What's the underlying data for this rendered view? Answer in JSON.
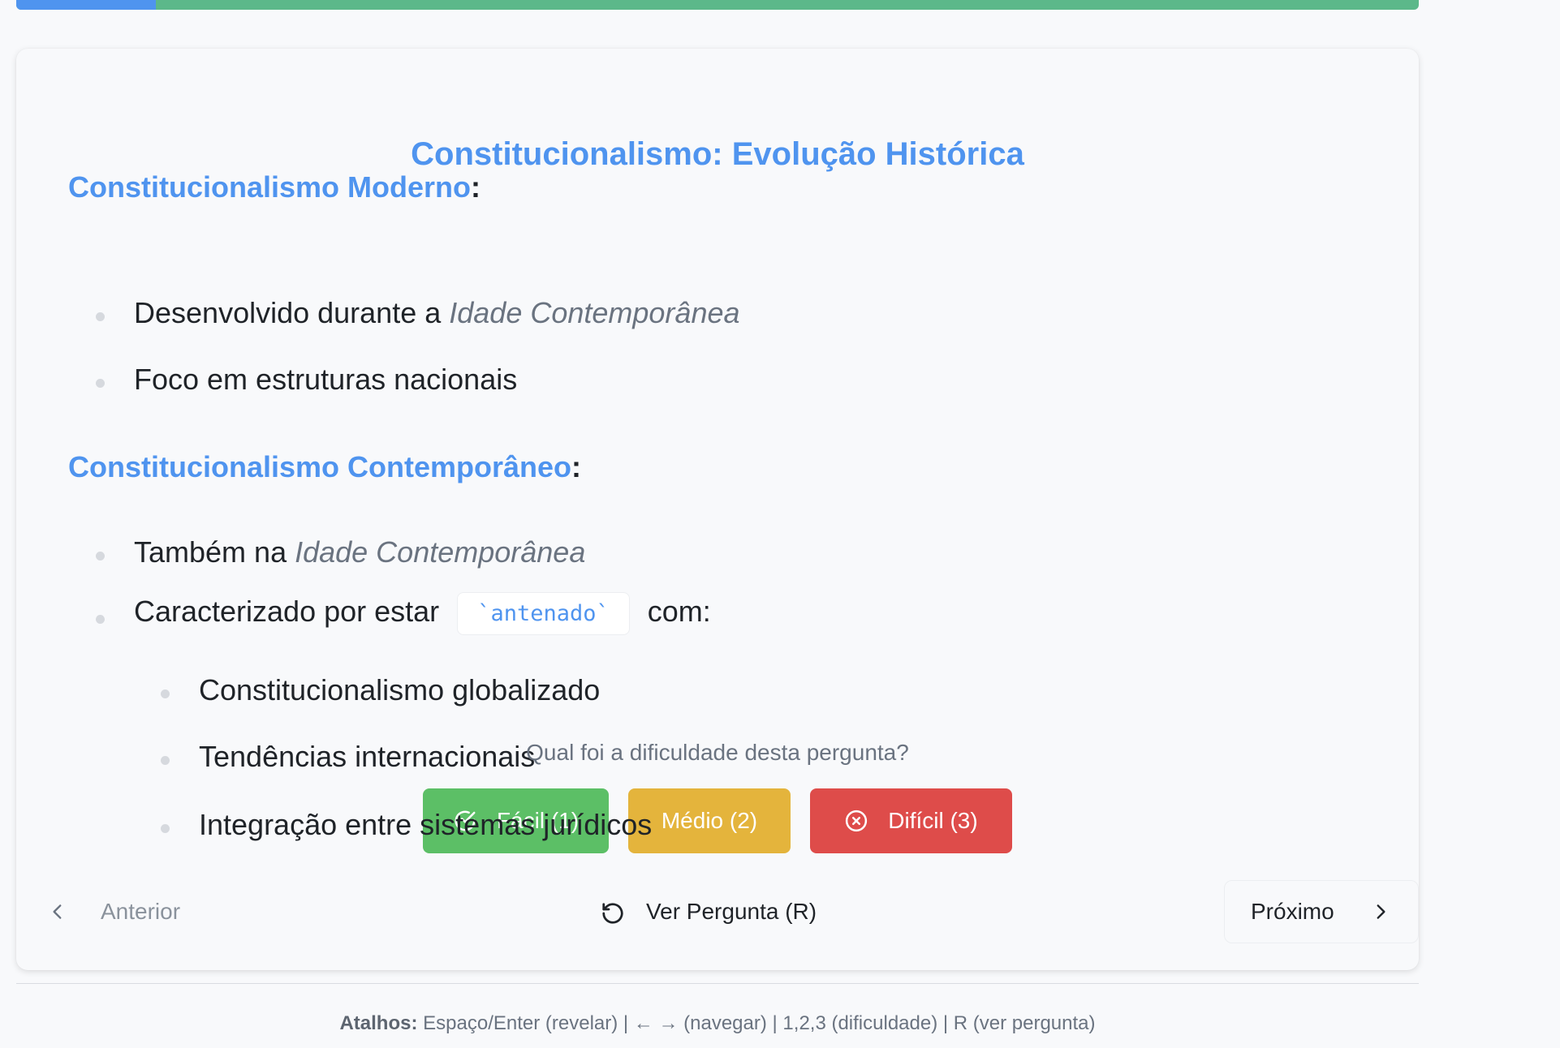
{
  "progress": {
    "fraction": 0.0995,
    "fill_color": "#4f94ef",
    "track_color": "#5cb88a"
  },
  "card": {
    "title": "Constitucionalismo: Evolução Histórica",
    "sections": [
      {
        "heading": "Constitucionalismo Moderno",
        "suffix": ":",
        "bullets": [
          {
            "text": "Desenvolvido durante a ",
            "emphasis": "Idade Contemporânea"
          },
          {
            "text": "Foco em estruturas nacionais"
          }
        ]
      },
      {
        "heading": "Constitucionalismo Contemporâneo",
        "suffix": ":",
        "bullets": [
          {
            "text": "Também na ",
            "emphasis": "Idade Contemporânea"
          },
          {
            "text": "Caracterizado por estar ",
            "code": "`antenado`",
            "after": " com:"
          }
        ],
        "sub_bullets": [
          "Constitucionalismo globalizado",
          "Tendências internacionais",
          "Integração entre sistemas jurídicos"
        ]
      }
    ]
  },
  "difficulty": {
    "question": "Qual foi a dificuldade desta pergunta?",
    "easy_label": "Fácil (1)",
    "medium_label": "Médio (2)",
    "hard_label": "Difícil (3)",
    "easy_color": "#5cbf66",
    "medium_color": "#e4b43c",
    "hard_color": "#de4c4a"
  },
  "nav": {
    "prev_label": "Anterior",
    "review_label": "Ver Pergunta (R)",
    "next_label": "Próximo"
  },
  "shortcuts": {
    "label": "Atalhos:",
    "text": " Espaço/Enter (revelar) | ← → (navegar) | 1,2,3 (dificuldade) | R (ver pergunta)"
  },
  "icons": {
    "prev": "chevron-left-icon",
    "next": "chevron-right-icon",
    "review": "rotate-ccw-icon",
    "easy": "check-circle-icon",
    "hard": "x-circle-icon"
  }
}
